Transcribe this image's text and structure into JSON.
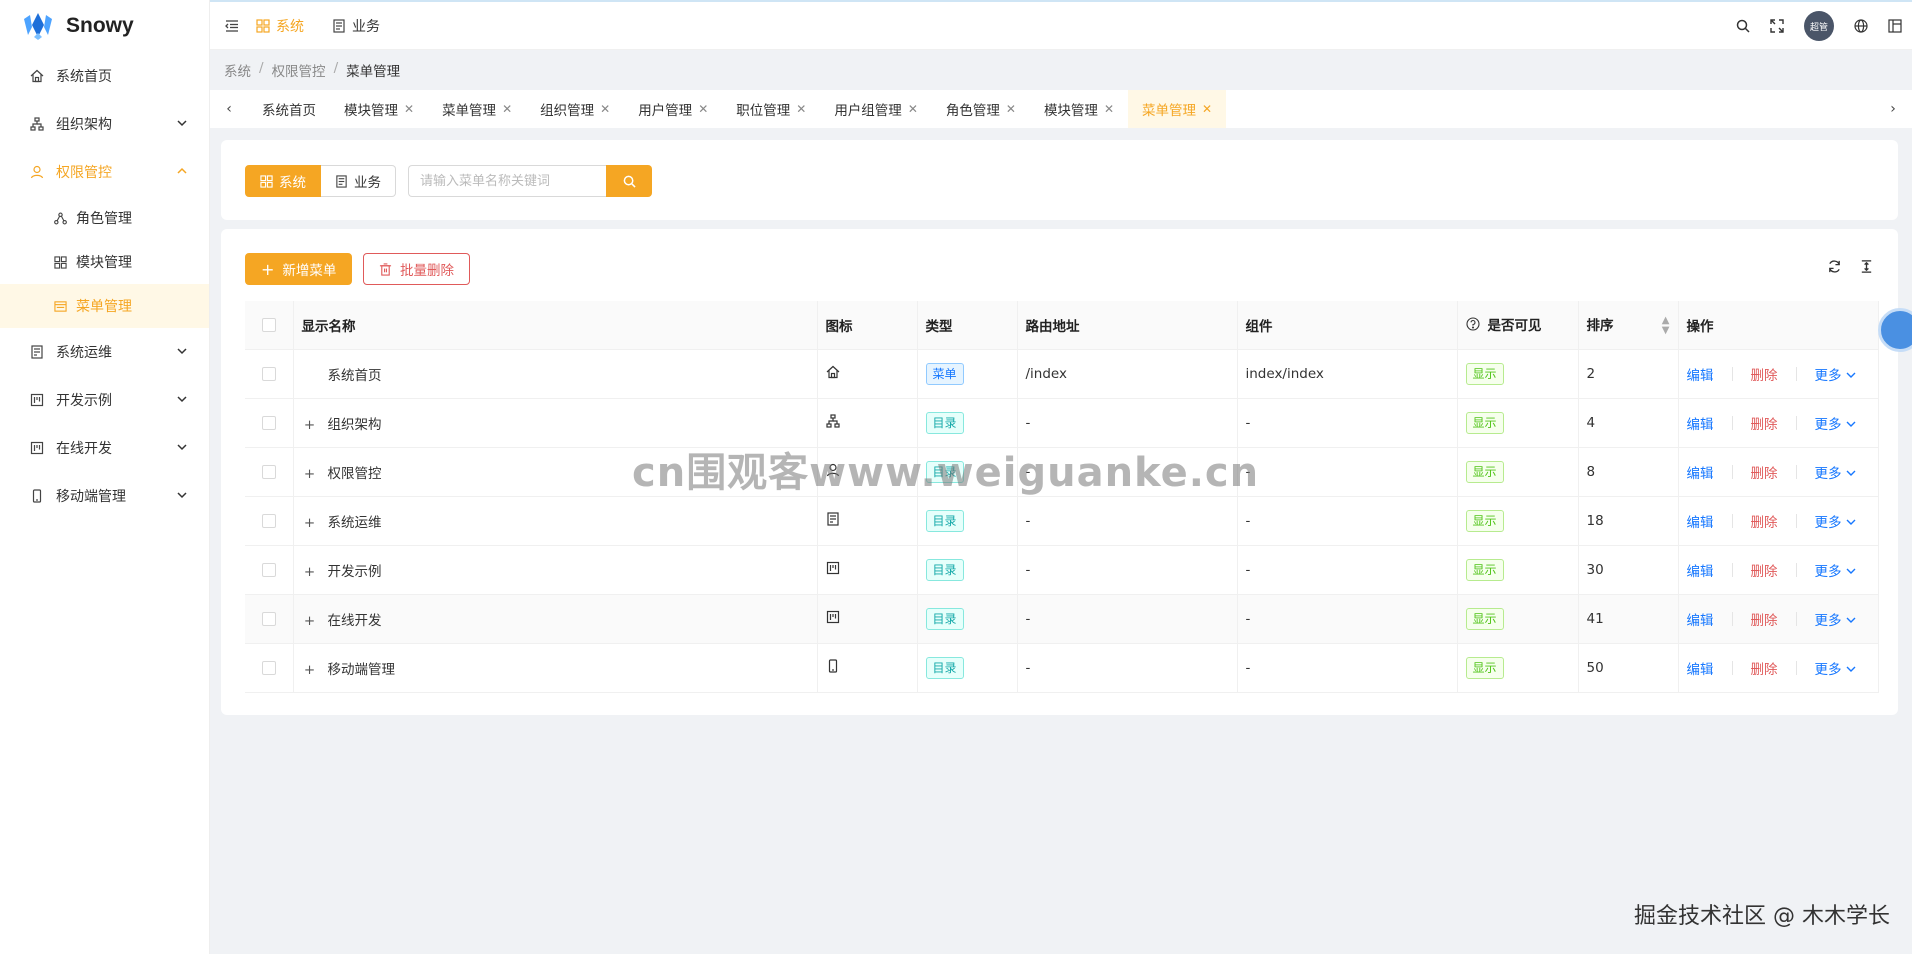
{
  "app": {
    "title": "Snowy"
  },
  "sidebar": {
    "items": [
      {
        "label": "系统首页",
        "icon": "home-icon",
        "expandable": false
      },
      {
        "label": "组织架构",
        "icon": "org-icon",
        "expandable": true
      },
      {
        "label": "权限管控",
        "icon": "user-icon",
        "expandable": true,
        "open": true,
        "children": [
          {
            "label": "角色管理",
            "icon": "share-icon"
          },
          {
            "label": "模块管理",
            "icon": "grid-icon"
          },
          {
            "label": "菜单管理",
            "icon": "menu-icon",
            "active": true
          }
        ]
      },
      {
        "label": "系统运维",
        "icon": "book-icon",
        "expandable": true
      },
      {
        "label": "开发示例",
        "icon": "project-icon",
        "expandable": true
      },
      {
        "label": "在线开发",
        "icon": "project-icon",
        "expandable": true
      },
      {
        "label": "移动端管理",
        "icon": "mobile-icon",
        "expandable": true
      }
    ]
  },
  "topnav": {
    "system": "系统",
    "business": "业务"
  },
  "header": {
    "avatar_text": "超管"
  },
  "breadcrumb": {
    "items": [
      "系统",
      "权限管控",
      "菜单管理"
    ]
  },
  "tabs": [
    "系统首页",
    "模块管理",
    "菜单管理",
    "组织管理",
    "用户管理",
    "职位管理",
    "用户组管理",
    "角色管理",
    "模块管理",
    "菜单管理"
  ],
  "filter": {
    "seg_system": "系统",
    "seg_business": "业务",
    "search_placeholder": "请输入菜单名称关键词"
  },
  "toolbar": {
    "add_label": "新增菜单",
    "batch_delete_label": "批量删除"
  },
  "table": {
    "headers": {
      "name": "显示名称",
      "icon": "图标",
      "type": "类型",
      "path": "路由地址",
      "component": "组件",
      "visible": "是否可见",
      "sort": "排序",
      "ops": "操作"
    },
    "rows": [
      {
        "name": "系统首页",
        "icon": "home-icon",
        "type": "菜单",
        "type_kind": "menu",
        "path": "/index",
        "component": "index/index",
        "visible": "显示",
        "sort": "2",
        "expandable": false
      },
      {
        "name": "组织架构",
        "icon": "org-icon",
        "type": "目录",
        "type_kind": "dir",
        "path": "-",
        "component": "-",
        "visible": "显示",
        "sort": "4",
        "expandable": true
      },
      {
        "name": "权限管控",
        "icon": "user-icon",
        "type": "目录",
        "type_kind": "dir",
        "path": "-",
        "component": "-",
        "visible": "显示",
        "sort": "8",
        "expandable": true
      },
      {
        "name": "系统运维",
        "icon": "book-icon",
        "type": "目录",
        "type_kind": "dir",
        "path": "-",
        "component": "-",
        "visible": "显示",
        "sort": "18",
        "expandable": true
      },
      {
        "name": "开发示例",
        "icon": "project-icon",
        "type": "目录",
        "type_kind": "dir",
        "path": "-",
        "component": "-",
        "visible": "显示",
        "sort": "30",
        "expandable": true
      },
      {
        "name": "在线开发",
        "icon": "project-icon",
        "type": "目录",
        "type_kind": "dir",
        "path": "-",
        "component": "-",
        "visible": "显示",
        "sort": "41",
        "expandable": true,
        "highlight": true
      },
      {
        "name": "移动端管理",
        "icon": "mobile-icon",
        "type": "目录",
        "type_kind": "dir",
        "path": "-",
        "component": "-",
        "visible": "显示",
        "sort": "50",
        "expandable": true
      }
    ],
    "actions": {
      "edit": "编辑",
      "delete": "删除",
      "more": "更多"
    }
  },
  "watermark": "cn围观客www.weiguanke.cn",
  "footer_watermark": "掘金技术社区 @ 木木学长",
  "colors": {
    "accent": "#f5a623",
    "danger": "#e05a5a",
    "link": "#1677ff"
  }
}
